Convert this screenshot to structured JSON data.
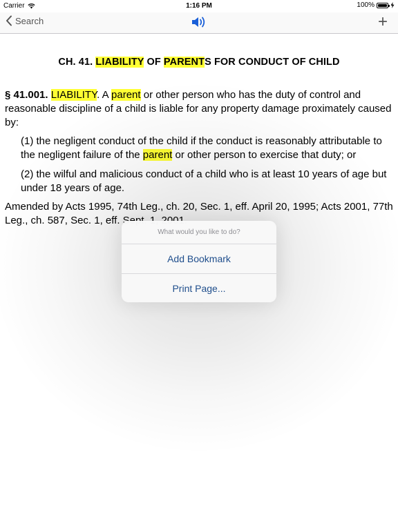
{
  "status_bar": {
    "carrier": "Carrier",
    "time": "1:16 PM",
    "battery_percent": "100%",
    "wifi_icon": "wifi-icon",
    "battery_icon": "battery-icon",
    "charging_icon": "bolt-icon"
  },
  "nav": {
    "back_label": "Search",
    "back_icon": "chevron-left-icon",
    "speaker_icon": "speaker-icon",
    "plus_label": "+",
    "accent_color": "#1a5fd8"
  },
  "document": {
    "title_parts": [
      "CH. 41. ",
      "LIABILITY",
      " OF ",
      "PARENT",
      "S FOR CONDUCT OF CHILD"
    ],
    "main": {
      "section": "§ 41.001.",
      "sp1": " ",
      "term": "LIABILITY",
      "t1": ". A ",
      "parent": "parent",
      "t2": " or other person who has the duty of control and reasonable discipline of a child is liable for any property damage proximately caused by:"
    },
    "item1": {
      "a": "(1) the negligent conduct of the child if the conduct is reasonably attributable to the negligent failure of the ",
      "parent": "parent",
      "b": " or other person to exercise that duty; or"
    },
    "item2": "(2) the wilful and malicious conduct of a child who is at least 10 years of age but under 18 years of age.",
    "amended": "Amended by Acts 1995, 74th Leg., ch. 20, Sec. 1, eff. April 20, 1995; Acts 2001, 77th Leg., ch. 587, Sec. 1, eff. Sept. 1, 2001.",
    "highlight_color": "#ffff33"
  },
  "popover": {
    "prompt": "What would you like to do?",
    "actions": [
      "Add Bookmark",
      "Print Page..."
    ],
    "action_color": "#1f4e8c"
  }
}
